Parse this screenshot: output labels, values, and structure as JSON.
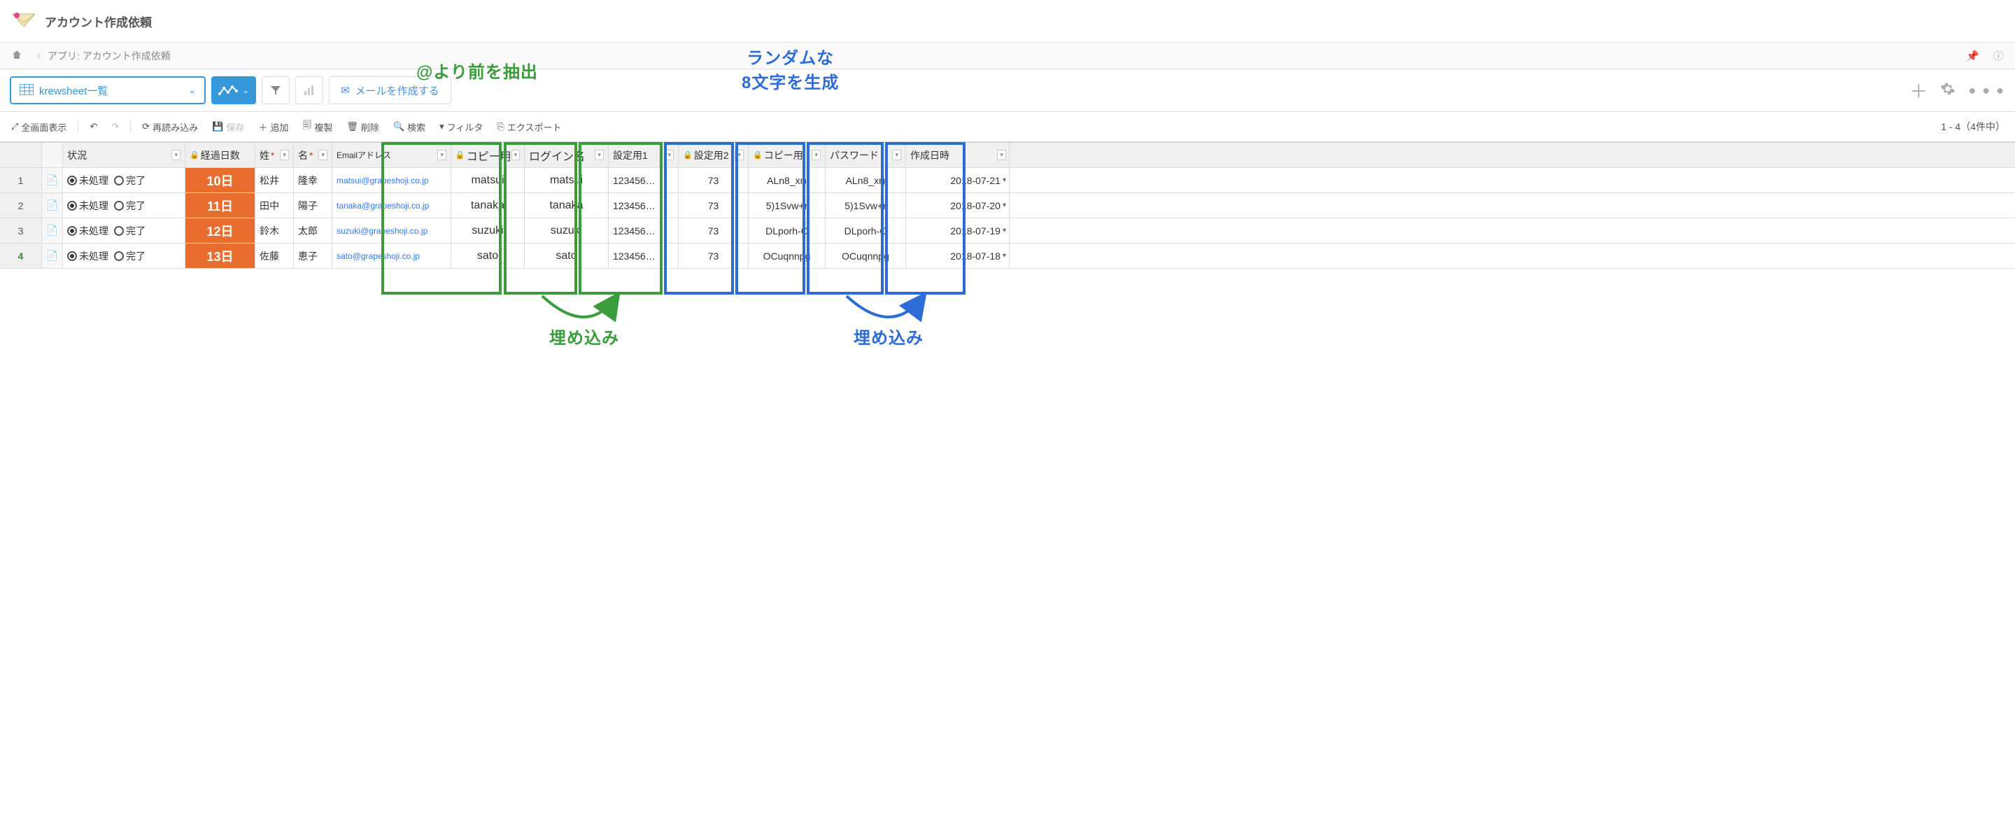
{
  "header": {
    "title": "アカウント作成依頼"
  },
  "breadcrumb": {
    "text": "アプリ: アカウント作成依頼"
  },
  "toolbar": {
    "view_name": "krewsheet一覧",
    "mail_label": "メールを作成する"
  },
  "actions": {
    "fullscreen": "全画面表示",
    "reload": "再読み込み",
    "save": "保存",
    "add": "追加",
    "duplicate": "複製",
    "delete": "削除",
    "search": "検索",
    "filter": "フィルタ",
    "export": "エクスポート"
  },
  "pagination": "1 - 4（4件中）",
  "columns": {
    "status": "状況",
    "days": "経過日数",
    "lastname": "姓",
    "firstname": "名",
    "email": "Emailアドレス",
    "copy1": "コピー用",
    "login": "ログイン名",
    "set1": "設定用1",
    "set2": "設定用2",
    "copy2": "コピー用",
    "pwd": "パスワード",
    "created": "作成日時"
  },
  "status_labels": {
    "pending": "未処理",
    "done": "完了"
  },
  "rows": [
    {
      "n": "1",
      "days": "10日",
      "lastname": "松井",
      "firstname": "隆幸",
      "email": "matsui@grapeshoji.co.jp",
      "copy1": "matsui",
      "login": "matsui",
      "set1": "123456…",
      "set2": "73",
      "copy2": "ALn8_xr)",
      "pwd": "ALn8_xr)",
      "created": "2018-07-21"
    },
    {
      "n": "2",
      "days": "11日",
      "lastname": "田中",
      "firstname": "陽子",
      "email": "tanaka@grapeshoji.co.jp",
      "copy1": "tanaka",
      "login": "tanaka",
      "set1": "123456…",
      "set2": "73",
      "copy2": "5)1Svw+r",
      "pwd": "5)1Svw+r",
      "created": "2018-07-20"
    },
    {
      "n": "3",
      "days": "12日",
      "lastname": "鈴木",
      "firstname": "太郎",
      "email": "suzuki@grapeshoji.co.jp",
      "copy1": "suzuki",
      "login": "suzuki",
      "set1": "123456…",
      "set2": "73",
      "copy2": "DLporh-C",
      "pwd": "DLporh-C",
      "created": "2018-07-19"
    },
    {
      "n": "4",
      "days": "13日",
      "lastname": "佐藤",
      "firstname": "恵子",
      "email": "sato@grapeshoji.co.jp",
      "copy1": "sato",
      "login": "sato",
      "set1": "123456…",
      "set2": "73",
      "copy2": "OCuqnnpg",
      "pwd": "OCuqnnpg",
      "created": "2018-07-18"
    }
  ],
  "annotations": {
    "extract": "@より前を抽出",
    "embed1": "埋め込み",
    "random": "ランダムな\n8文字を生成",
    "embed2": "埋め込み"
  }
}
